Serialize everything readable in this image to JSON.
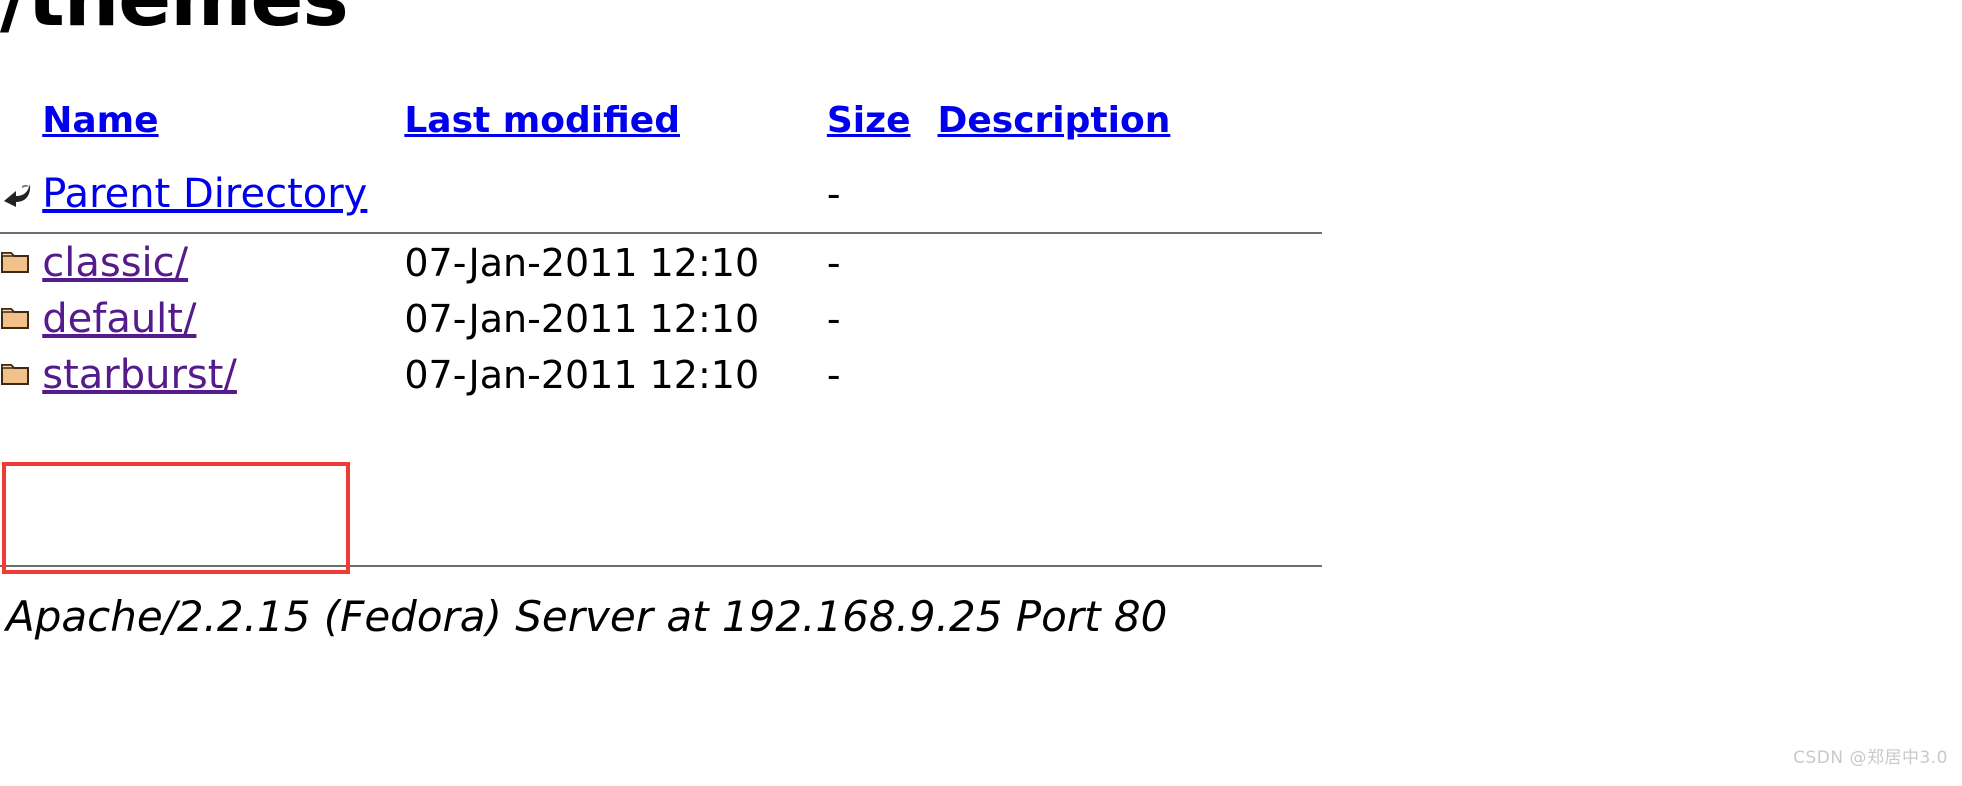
{
  "page": {
    "title": "/themes",
    "background_color": "#ffffff"
  },
  "colors": {
    "link_unvisited": "#0000ee",
    "link_visited": "#551a8b",
    "rule": "#6e6e6e",
    "annotation": "#ef3b36",
    "folder_fill": "#f2c18a",
    "folder_outline": "#3a2a16",
    "watermark": "#c9c9c9"
  },
  "table": {
    "headers": [
      {
        "label": "Name",
        "icon": ""
      },
      {
        "label": "Last modified",
        "icon": ""
      },
      {
        "label": "Size",
        "icon": ""
      },
      {
        "label": "Description",
        "icon": ""
      }
    ],
    "rows": [
      {
        "icon": "back-arrow-icon",
        "name": "Parent Directory",
        "last_modified": "",
        "size": "-",
        "description": "",
        "visited": false
      },
      {
        "icon": "folder-icon",
        "name": "classic/",
        "last_modified": "07-Jan-2011 12:10",
        "size": "-",
        "description": "",
        "visited": true
      },
      {
        "icon": "folder-icon",
        "name": "default/",
        "last_modified": "07-Jan-2011 12:10",
        "size": "-",
        "description": "",
        "visited": true
      },
      {
        "icon": "folder-icon",
        "name": "starburst/",
        "last_modified": "07-Jan-2011 12:10",
        "size": "-",
        "description": "",
        "visited": true
      }
    ]
  },
  "annotation": {
    "target": "starburst/",
    "shape": "rectangle",
    "color": "#ef3b36"
  },
  "footer": {
    "text": "Apache/2.2.15 (Fedora) Server at 192.168.9.25 Port 80"
  },
  "watermark": {
    "text": "CSDN @郑居中3.0"
  }
}
